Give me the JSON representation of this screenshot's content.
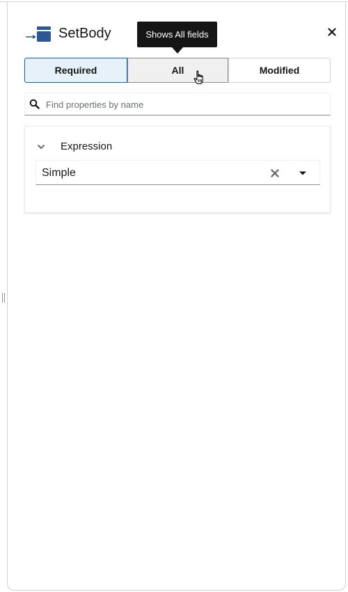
{
  "panel": {
    "title": "SetBody",
    "close_icon": "close-icon",
    "node_icon": "set-body-icon"
  },
  "tooltip": {
    "text": "Shows All fields"
  },
  "filter_toggle": {
    "options": [
      {
        "label": "Required",
        "selected": true
      },
      {
        "label": "All",
        "selected": false,
        "hovered": true
      },
      {
        "label": "Modified",
        "selected": false
      }
    ]
  },
  "search": {
    "placeholder": "Find properties by name",
    "value": "",
    "icon": "search-icon"
  },
  "expression_section": {
    "title": "Expression",
    "expanded": true,
    "select": {
      "value": "Simple",
      "clear_icon": "clear-icon",
      "toggle_icon": "caret-down-icon"
    }
  },
  "colors": {
    "accent": "#0066cc",
    "selected_bg": "#e7f1fa",
    "node_icon_blue": "#2b5797",
    "tooltip_bg": "#151515"
  }
}
